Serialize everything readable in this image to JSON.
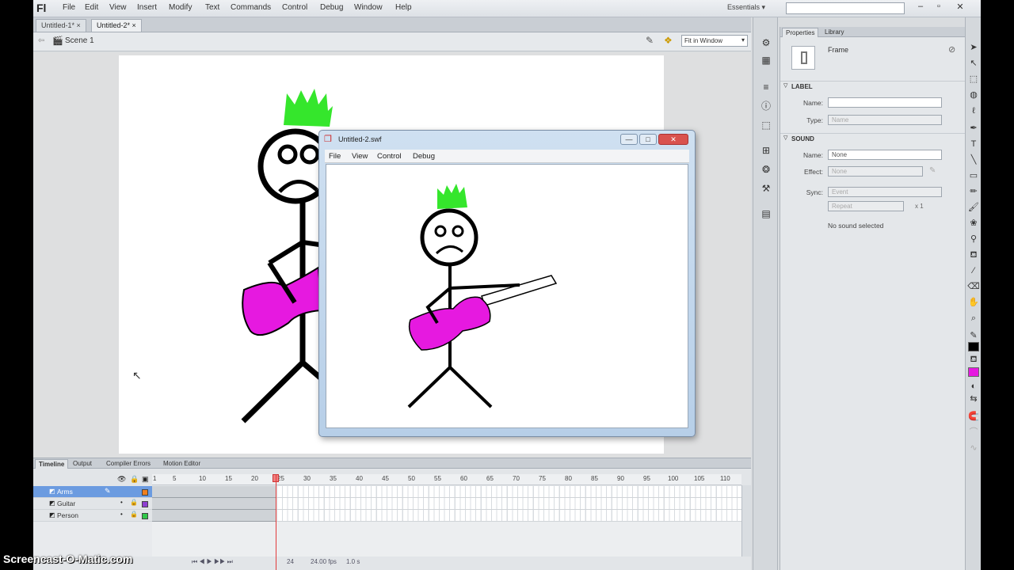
{
  "app": {
    "logo": "Fl",
    "workspace": "Essentials ▾",
    "search_placeholder": ""
  },
  "menu": [
    "File",
    "Edit",
    "View",
    "Insert",
    "Modify",
    "Text",
    "Commands",
    "Control",
    "Debug",
    "Window",
    "Help"
  ],
  "doc_tabs": [
    {
      "label": "Untitled-1* ×"
    },
    {
      "label": "Untitled-2* ×"
    }
  ],
  "editbar": {
    "scene": "Scene 1",
    "zoom": "Fit in Window"
  },
  "swf_window": {
    "title": "Untitled-2.swf",
    "menu": [
      "File",
      "View",
      "Control",
      "Debug"
    ],
    "controls": [
      "—",
      "□",
      "✕"
    ]
  },
  "colors": {
    "hair": "#35e62c",
    "guitar": "#e619e0",
    "selected_layer": "#6b9be0",
    "playhead": "#e23b3b"
  },
  "properties": {
    "tabs": [
      "Properties",
      "Library"
    ],
    "frame_label": "Frame",
    "label_section": "LABEL",
    "name_label": "Name:",
    "type_label": "Type:",
    "type_value": "Name",
    "sound_section": "SOUND",
    "sound_name_label": "Name:",
    "sound_name_value": "None",
    "effect_label": "Effect:",
    "effect_value": "None",
    "sync_label": "Sync:",
    "sync_value": "Event",
    "repeat_value": "Repeat",
    "repeat_count": "x 1",
    "no_sound": "No sound selected"
  },
  "timeline": {
    "tabs": [
      "Timeline",
      "Output",
      "Compiler Errors",
      "Motion Editor"
    ],
    "ruler": [
      "1",
      "5",
      "10",
      "15",
      "20",
      "25",
      "30",
      "35",
      "40",
      "45",
      "50",
      "55",
      "60",
      "65",
      "70",
      "75",
      "80",
      "85",
      "90",
      "95",
      "100",
      "105",
      "110"
    ],
    "layers": [
      {
        "name": "Arms",
        "color": "#f07f1e"
      },
      {
        "name": "Guitar",
        "color": "#8e3fd1"
      },
      {
        "name": "Person",
        "color": "#30c84a"
      }
    ],
    "footer": {
      "frame": "24",
      "fps": "24.00 fps",
      "time": "1.0 s"
    }
  },
  "watermark": "Screencast-O-Matic.com"
}
